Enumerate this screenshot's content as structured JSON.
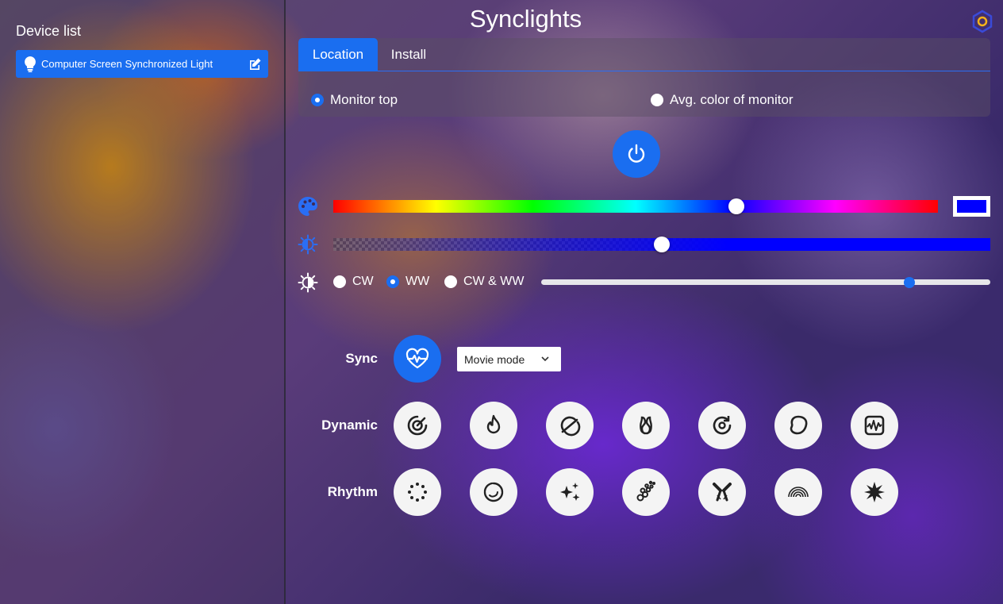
{
  "sidebar": {
    "title": "Device list",
    "devices": [
      {
        "name": "Computer Screen Synchronized Light"
      }
    ]
  },
  "header": {
    "title": "Synclights"
  },
  "tabs": [
    {
      "label": "Location",
      "active": true
    },
    {
      "label": "Install",
      "active": false
    }
  ],
  "location": {
    "options": [
      {
        "label": "Monitor top",
        "checked": true
      },
      {
        "label": "Avg. color of monitor",
        "checked": false
      }
    ]
  },
  "controls": {
    "hue_position": 0.667,
    "selected_color": "#0000ff",
    "brightness_level": 0.5,
    "temperature_level": 0.82,
    "temperature_options": [
      {
        "label": "CW",
        "checked": false
      },
      {
        "label": "WW",
        "checked": true
      },
      {
        "label": "CW & WW",
        "checked": false
      }
    ]
  },
  "modes": {
    "sync_label": "Sync",
    "sync_mode_selected": "Movie mode",
    "dynamic_label": "Dynamic",
    "rhythm_label": "Rhythm",
    "dynamic_icons": [
      "target-spiral-icon",
      "flame-icon",
      "circle-slash-icon",
      "loop-icon",
      "rotate-dot-icon",
      "blob-icon",
      "waveform-icon"
    ],
    "rhythm_icons": [
      "dots-circle-icon",
      "swirl-icon",
      "sparkles-icon",
      "bubbles-icon",
      "cross-rays-icon",
      "rainbow-icon",
      "burst-icon"
    ]
  },
  "colors": {
    "accent": "#1a6ef0"
  }
}
